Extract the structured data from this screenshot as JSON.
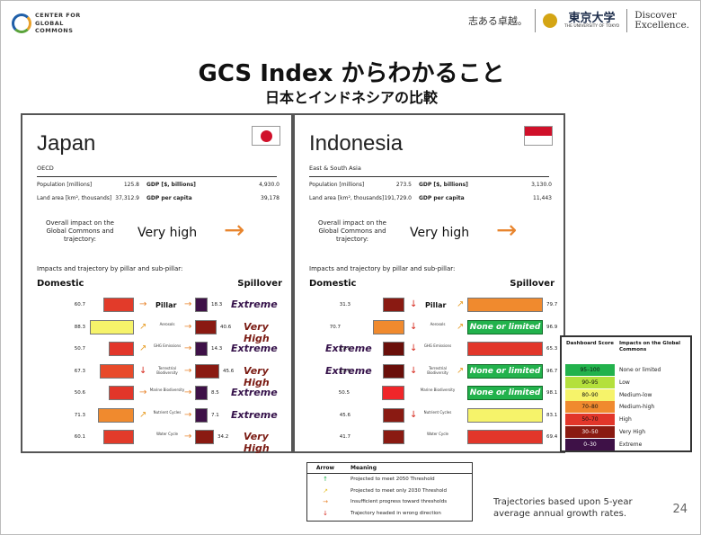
{
  "header": {
    "org_lines": [
      "CENTER FOR",
      "GLOBAL",
      "COMMONS"
    ],
    "motto": "志ある卓越。",
    "utokyo_name": "東京大学",
    "utokyo_sub": "THE UNIVERSITY OF TOKYO",
    "discover": [
      "Discover",
      "Excellence."
    ]
  },
  "title": "GCS Index からわかること",
  "subtitle": "日本とインドネシアの比較",
  "common": {
    "population_label": "Population [millions]",
    "gdp_label": "GDP [$, billions]",
    "land_label": "Land area [km², thousands]",
    "gdppc_label": "GDP per capita",
    "overall_label": "Overall impact on the Global Commons and trajectory:",
    "pillar_caption": "Impacts and trajectory by pillar and sub-pillar:",
    "domestic": "Domestic",
    "spillover": "Spillover",
    "pillar_word": "Pillar",
    "overall_arrow": "→"
  },
  "row_labels": [
    "",
    "Aerosols",
    "GHG Emissions",
    "Terrestrial Biodiversity",
    "Marine Biodiversity",
    "Nutrient Cycles",
    "Water Cycle"
  ],
  "japan": {
    "name": "Japan",
    "region": "OECD",
    "population": "125.8",
    "gdp": "4,930.0",
    "land": "37,312.9",
    "gdppc": "39,178",
    "overall": "Very high",
    "rows": [
      {
        "dom": "60.7",
        "dom_color": "#e23b2a",
        "arrow": "→",
        "arrow_color": "#e8852e",
        "sp": "18.3",
        "sp_color": "#3e1147",
        "sp_label": "Extreme"
      },
      {
        "dom": "88.3",
        "dom_color": "#f6f36a",
        "arrow": "↗",
        "arrow_color": "#e8a12e",
        "sp": "40.6",
        "sp_color": "#8a1a12",
        "sp_label": "Very High"
      },
      {
        "dom": "50.7",
        "dom_color": "#e2362a",
        "arrow": "↗",
        "arrow_color": "#e8a12e",
        "sp": "14.3",
        "sp_color": "#3e1147",
        "sp_label": "Extreme"
      },
      {
        "dom": "67.3",
        "dom_color": "#e84a2a",
        "arrow": "↓",
        "arrow_color": "#d62a1e",
        "sp": "45.6",
        "sp_color": "#8a1a12",
        "sp_label": "Very High"
      },
      {
        "dom": "50.6",
        "dom_color": "#e2362a",
        "arrow": "→",
        "arrow_color": "#e8852e",
        "sp": "8.5",
        "sp_color": "#3e1147",
        "sp_label": "Extreme"
      },
      {
        "dom": "71.3",
        "dom_color": "#f08a2e",
        "arrow": "↗",
        "arrow_color": "#e8a12e",
        "sp": "7.1",
        "sp_color": "#3e1147",
        "sp_label": "Extreme"
      },
      {
        "dom": "60.1",
        "dom_color": "#e23b2a",
        "arrow": "",
        "arrow_color": "#e8852e",
        "sp": "34.2",
        "sp_color": "#8a1a12",
        "sp_label": "Very High"
      }
    ]
  },
  "indonesia": {
    "name": "Indonesia",
    "region": "East & South Asia",
    "population": "273.5",
    "gdp": "3,130.0",
    "land": "191,729.0",
    "gdppc": "11,443",
    "overall": "Very high",
    "rows": [
      {
        "dom": "31.3",
        "dom_color": "#8a1a12",
        "dom_label": "",
        "arrow": "↓",
        "arrow_color": "#d62a1e",
        "sp_arrow": "↗",
        "sp": "79.7",
        "sp_color": "#f08a2e",
        "sp_label": ""
      },
      {
        "dom": "70.7",
        "dom_color": "#f08a2e",
        "dom_label": "",
        "arrow": "↓",
        "arrow_color": "#d62a1e",
        "sp_arrow": "↗",
        "sp": "96.9",
        "sp_color": "#22b24c",
        "sp_label": "None or limited"
      },
      {
        "dom": "19.0",
        "dom_color": "#6a0f0a",
        "dom_label": "Extreme",
        "arrow": "↓",
        "arrow_color": "#d62a1e",
        "sp_arrow": "",
        "sp": "65.3",
        "sp_color": "#e2362a",
        "sp_label": ""
      },
      {
        "dom": "15.4",
        "dom_color": "#6a0f0a",
        "dom_label": "Extreme",
        "arrow": "↓",
        "arrow_color": "#d62a1e",
        "sp_arrow": "↗",
        "sp": "96.7",
        "sp_color": "#22b24c",
        "sp_label": "None or limited"
      },
      {
        "dom": "50.5",
        "dom_color": "#f0262a",
        "dom_label": "",
        "arrow": "",
        "arrow_color": "#d62a1e",
        "sp_arrow": "",
        "sp": "98.1",
        "sp_color": "#22b24c",
        "sp_label": "None or limited"
      },
      {
        "dom": "45.6",
        "dom_color": "#8a1a12",
        "dom_label": "",
        "arrow": "↓",
        "arrow_color": "#d62a1e",
        "sp_arrow": "",
        "sp": "83.1",
        "sp_color": "#f6f36a",
        "sp_label": ""
      },
      {
        "dom": "41.7",
        "dom_color": "#8a1a12",
        "dom_label": "",
        "arrow": "",
        "arrow_color": "#d62a1e",
        "sp_arrow": "",
        "sp": "69.4",
        "sp_color": "#e2362a",
        "sp_label": ""
      }
    ]
  },
  "legend": {
    "col1": "Dashboard Score",
    "col2": "Impacts on the Global Commons",
    "rows": [
      {
        "range": "95–100",
        "label": "None or limited",
        "color": "#22b24c",
        "text_color": "#111"
      },
      {
        "range": "90–95",
        "label": "Low",
        "color": "#b4e03c",
        "text_color": "#111"
      },
      {
        "range": "80–90",
        "label": "Medium-low",
        "color": "#f6f36a",
        "text_color": "#111"
      },
      {
        "range": "70–80",
        "label": "Medium-high",
        "color": "#f08a2e",
        "text_color": "#111"
      },
      {
        "range": "50–70",
        "label": "High",
        "color": "#e2362a",
        "text_color": "#111"
      },
      {
        "range": "30–50",
        "label": "Very High",
        "color": "#8a1a12",
        "text_color": "#fff"
      },
      {
        "range": "0–30",
        "label": "Extreme",
        "color": "#3e1147",
        "text_color": "#fff"
      }
    ]
  },
  "arrow_table": {
    "col1": "Arrow",
    "col2": "Meaning",
    "rows": [
      {
        "arrow": "↑",
        "color": "#22b24c",
        "text": "Projected to meet 2050 Threshold"
      },
      {
        "arrow": "↗",
        "color": "#e8c12e",
        "text": "Projected to meet only 2030 Threshold"
      },
      {
        "arrow": "→",
        "color": "#e8852e",
        "text": "Insufficient progress toward thresholds"
      },
      {
        "arrow": "↓",
        "color": "#d62a1e",
        "text": "Trajectory headed in wrong direction"
      }
    ]
  },
  "trajectory_note": [
    "Trajectories based upon 5-year",
    "average annual growth rates."
  ],
  "page_number": "24"
}
